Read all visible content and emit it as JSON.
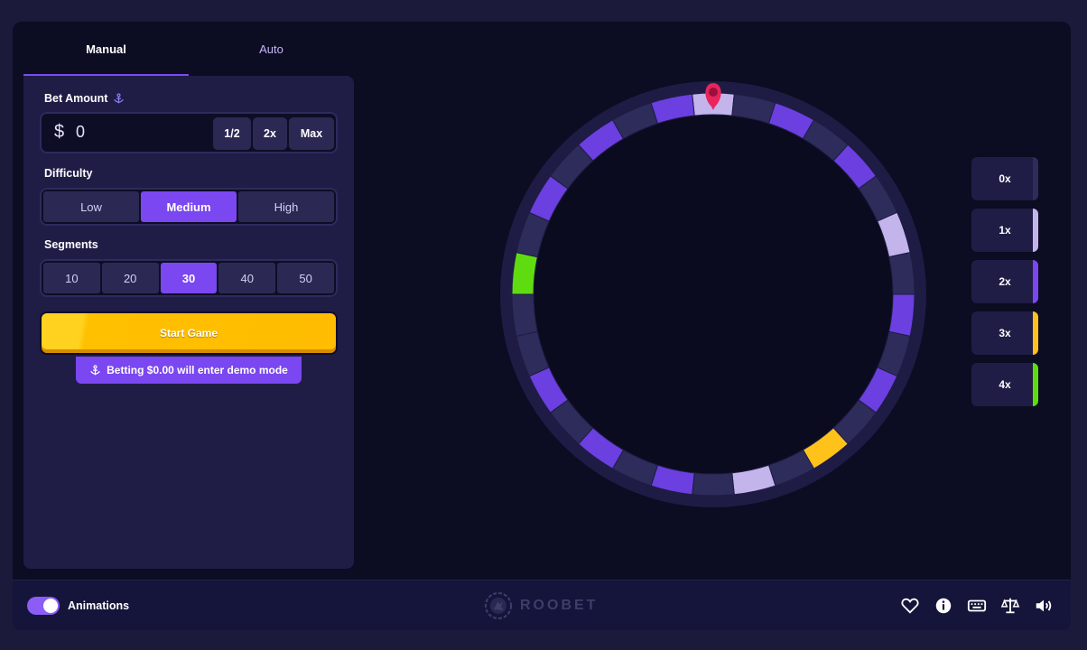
{
  "tabs": {
    "manual": "Manual",
    "auto": "Auto"
  },
  "bet": {
    "label": "Bet Amount",
    "currency": "$",
    "value": "0",
    "half": "1/2",
    "double": "2x",
    "max": "Max"
  },
  "difficulty": {
    "label": "Difficulty",
    "options": [
      "Low",
      "Medium",
      "High"
    ],
    "selected": "Medium"
  },
  "segments": {
    "label": "Segments",
    "options": [
      "10",
      "20",
      "30",
      "40",
      "50"
    ],
    "selected": "30"
  },
  "start_button": "Start Game",
  "demo_note": "Betting $0.00 will enter demo mode",
  "wheel": {
    "segment_count": 30,
    "segments": [
      "1x",
      "0x",
      "2x",
      "0x",
      "2x",
      "0x",
      "1x",
      "0x",
      "2x",
      "0x",
      "2x",
      "0x",
      "3x",
      "0x",
      "1x",
      "0x",
      "2x",
      "0x",
      "2x",
      "0x",
      "2x",
      "0x",
      "0x",
      "4x",
      "0x",
      "2x",
      "0x",
      "2x",
      "0x",
      "2x"
    ]
  },
  "multipliers": [
    {
      "label": "0x",
      "color": "#2e2c5a"
    },
    {
      "label": "1x",
      "color": "#c3b5ec"
    },
    {
      "label": "2x",
      "color": "#7a47f0"
    },
    {
      "label": "3x",
      "color": "#ffc21a"
    },
    {
      "label": "4x",
      "color": "#5fdc10"
    }
  ],
  "colors": {
    "0x": "#2e2c5a",
    "1x": "#c3b5ec",
    "2x": "#6b3fe0",
    "3x": "#ffc21a",
    "4x": "#5fdc10",
    "pointer": "#e8245c",
    "accent": "#7a47f0"
  },
  "footer": {
    "animations_label": "Animations",
    "animations_on": true,
    "brand": "ROOBET",
    "icons": [
      "heart-icon",
      "info-icon",
      "keyboard-icon",
      "scale-icon",
      "volume-icon"
    ]
  }
}
